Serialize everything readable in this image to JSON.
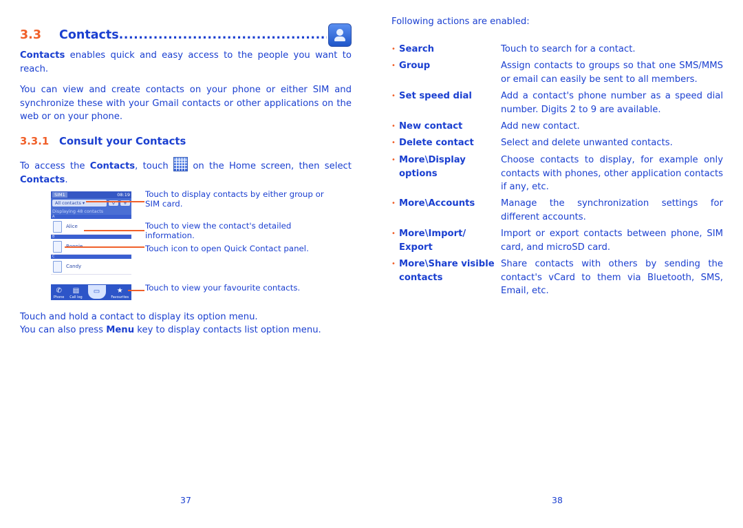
{
  "left_page": {
    "section": {
      "number": "3.3",
      "title": "Contacts",
      "dots": "........................................................................................................",
      "icon": "contacts-app-icon"
    },
    "intro": {
      "bold": "Contacts",
      "rest": " enables quick and easy access to the people you want to reach."
    },
    "para2": "You can view and create contacts on your phone or either SIM and synchronize these with your Gmail contacts or other applications on the web or on your phone.",
    "subsection": {
      "number": "3.3.1",
      "title": "Consult your Contacts"
    },
    "access": {
      "t1": "To access the ",
      "b1": "Contacts",
      "t2": ", touch ",
      "icon": "app-grid-icon",
      "t3": " on the Home screen, then select ",
      "b2": "Contacts",
      "t4": "."
    },
    "phone": {
      "status_sim": "SIM1",
      "status_time": "08:19",
      "dropdown": "All contacts",
      "search_icon": "search-icon",
      "add_label": "+",
      "info": "Displaying 48 contacts",
      "groups": [
        {
          "letter": "A",
          "contact": "Alice"
        },
        {
          "letter": "B",
          "contact": "Bonnie"
        },
        {
          "letter": "C",
          "contact": "Candy"
        }
      ],
      "nav": [
        {
          "label": "Phone",
          "icon": "phone-icon"
        },
        {
          "label": "Call log",
          "icon": "call-log-icon"
        },
        {
          "label": "",
          "icon": "contacts-tab-icon"
        },
        {
          "label": "Favourites",
          "icon": "star-icon"
        }
      ]
    },
    "callouts": [
      "Touch to display contacts by either group or SIM card.",
      "Touch to view the contact's detailed information.",
      "Touch icon to open Quick Contact panel.",
      "Touch to view your favourite contacts."
    ],
    "hold_text": "Touch and hold a contact to display its option menu.",
    "menu_text": {
      "t1": "You can also press ",
      "b1": "Menu",
      "t2": " key to display contacts list option menu."
    },
    "page_number": "37"
  },
  "right_page": {
    "intro": "Following actions are enabled:",
    "actions": [
      {
        "name": "Search",
        "desc": "Touch to search for a contact."
      },
      {
        "name": "Group",
        "desc": "Assign contacts to groups so that one SMS/MMS or email can easily be sent to all members."
      },
      {
        "name": "Set speed dial",
        "desc": "Add a contact's phone number as a speed dial number.  Digits 2 to 9 are available."
      },
      {
        "name": "New contact",
        "desc": "Add new contact."
      },
      {
        "name": "Delete contact",
        "desc": "Select and delete unwanted contacts."
      },
      {
        "name": "More\\Display options",
        "desc": "Choose contacts to display, for example only contacts with phones, other application contacts if any, etc."
      },
      {
        "name": "More\\Accounts",
        "desc": "Manage the synchronization settings for different accounts."
      },
      {
        "name": "More\\Import/ Export",
        "desc": "Import or export contacts between phone, SIM card, and microSD card."
      },
      {
        "name": "More\\Share visible contacts",
        "desc": "Share contacts with others by sending the contact's vCard to them via Bluetooth, SMS, Email, etc."
      }
    ],
    "bullet": "•",
    "page_number": "38"
  },
  "colors": {
    "text_blue": "#1a3fd0",
    "accent_orange": "#f0602a"
  }
}
